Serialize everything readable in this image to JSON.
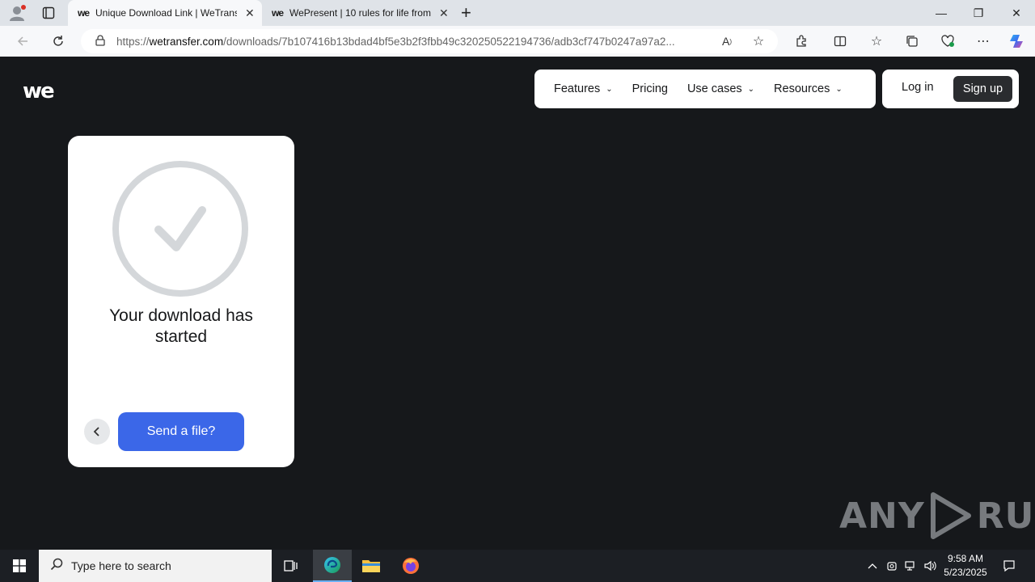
{
  "browser": {
    "tabs": [
      {
        "favicon": "we",
        "title": "Unique Download Link | WeTransfer",
        "close": "✕"
      },
      {
        "favicon": "we",
        "title": "WePresent | 10 rules for life from",
        "close": "✕"
      }
    ],
    "new_tab": "+",
    "window": {
      "minimize": "—",
      "restore": "❐",
      "close": "✕"
    },
    "address": {
      "prefix": "https://",
      "domain": "wetransfer.com",
      "path": "/downloads/7b107416b13bdad4bf5e3b2f3fbb49c320250522194736/adb3cf747b0247a97a2..."
    }
  },
  "page": {
    "logo": "we",
    "nav": [
      {
        "label": "Features",
        "has_dropdown": true
      },
      {
        "label": "Pricing",
        "has_dropdown": false
      },
      {
        "label": "Use cases",
        "has_dropdown": true
      },
      {
        "label": "Resources",
        "has_dropdown": true
      }
    ],
    "login_label": "Log in",
    "signup_label": "Sign up",
    "card": {
      "headline": "Your download has started",
      "send_label": "Send a file?"
    },
    "watermark": {
      "left": "ANY",
      "right": "RUN"
    }
  },
  "taskbar": {
    "search_placeholder": "Type here to search",
    "time": "9:58 AM",
    "date": "5/23/2025"
  },
  "colors": {
    "page_bg": "#16181b",
    "primary_button": "#3b67e8",
    "check": "#d4d7da"
  }
}
